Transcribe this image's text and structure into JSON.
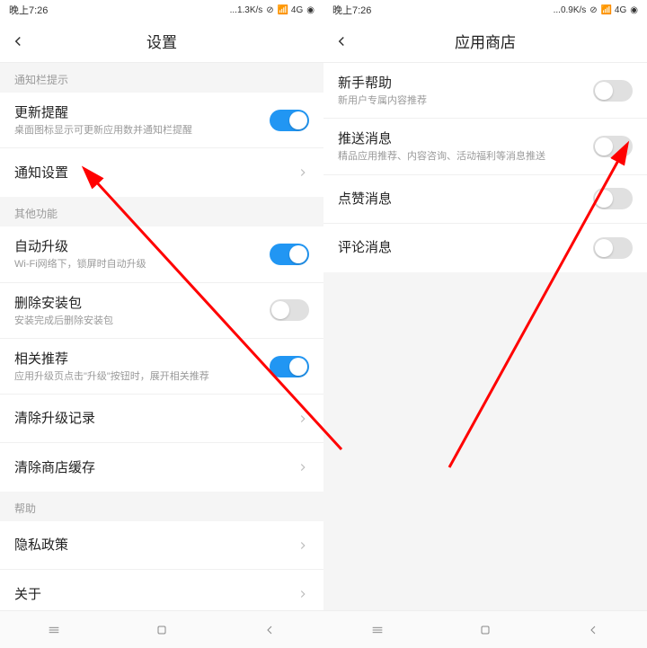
{
  "left": {
    "status": {
      "time": "晚上7:26",
      "speed": "...1.3K/s",
      "extra": "⊘",
      "signal": "📶 4G",
      "battery": "◉"
    },
    "header": {
      "title": "设置"
    },
    "section1_label": "通知栏提示",
    "rows1": [
      {
        "title": "更新提醒",
        "sub": "桌面图标显示可更新应用数并通知栏提醒",
        "type": "toggle",
        "on": true
      },
      {
        "title": "通知设置",
        "sub": "",
        "type": "chevron"
      }
    ],
    "section2_label": "其他功能",
    "rows2": [
      {
        "title": "自动升级",
        "sub": "Wi-Fi网络下，锁屏时自动升级",
        "type": "toggle",
        "on": true
      },
      {
        "title": "删除安装包",
        "sub": "安装完成后删除安装包",
        "type": "toggle",
        "on": false
      },
      {
        "title": "相关推荐",
        "sub": "应用升级页点击\"升级\"按钮时，展开相关推荐",
        "type": "toggle",
        "on": true
      },
      {
        "title": "清除升级记录",
        "sub": "",
        "type": "chevron"
      },
      {
        "title": "清除商店缓存",
        "sub": "",
        "type": "chevron"
      }
    ],
    "section3_label": "帮助",
    "rows3": [
      {
        "title": "隐私政策",
        "sub": "",
        "type": "chevron"
      },
      {
        "title": "关于",
        "sub": "",
        "type": "chevron"
      }
    ]
  },
  "right": {
    "status": {
      "time": "晚上7:26",
      "speed": "...0.9K/s",
      "extra": "⊘",
      "signal": "📶 4G",
      "battery": "◉"
    },
    "header": {
      "title": "应用商店"
    },
    "rows": [
      {
        "title": "新手帮助",
        "sub": "新用户专属内容推荐",
        "type": "toggle",
        "on": false
      },
      {
        "title": "推送消息",
        "sub": "精品应用推荐、内容咨询、活动福利等消息推送",
        "type": "toggle",
        "on": false
      },
      {
        "title": "点赞消息",
        "sub": "",
        "type": "toggle",
        "on": false
      },
      {
        "title": "评论消息",
        "sub": "",
        "type": "toggle",
        "on": false
      }
    ]
  }
}
